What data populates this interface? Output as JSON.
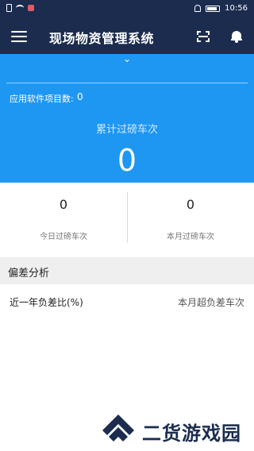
{
  "status_bar": {
    "time": "10:56",
    "icons": [
      "sim-icon",
      "wifi-icon",
      "app-notification-icon",
      "bell-off-icon",
      "battery-icon"
    ]
  },
  "nav": {
    "title": "现场物资管理系统",
    "icons": [
      "menu-icon",
      "scan-icon",
      "bell-icon"
    ]
  },
  "hero": {
    "collapse_icon": "chevron-down-icon",
    "app_count_label": "应用软件项目数:",
    "app_count_value": "0",
    "total_label": "累计过磅车次",
    "total_value": "0"
  },
  "stats": {
    "today_value": "0",
    "today_label": "今日过磅车次",
    "month_value": "0",
    "month_label": "本月过磅车次"
  },
  "analysis": {
    "section_title": "偏差分析",
    "left_label": "近一年负差比(%)",
    "right_label": "本月超负差车次"
  },
  "watermark": {
    "text": "二货游戏园"
  },
  "colors": {
    "nav_bg": "#1b2c4f",
    "hero_bg": "#1e97f3",
    "section_bg": "#efefef"
  }
}
